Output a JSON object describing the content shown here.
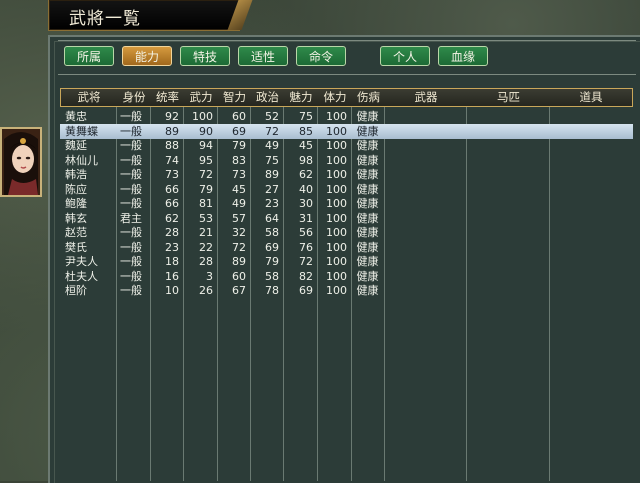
{
  "window": {
    "title": "武將一覧"
  },
  "tabs": [
    {
      "label": "所属",
      "active": false
    },
    {
      "label": "能力",
      "active": true
    },
    {
      "label": "特技",
      "active": false
    },
    {
      "label": "适性",
      "active": false
    },
    {
      "label": "命令",
      "active": false
    },
    {
      "label": "个人",
      "active": false
    },
    {
      "label": "血缘",
      "active": false
    }
  ],
  "columns": [
    "武将",
    "身份",
    "统率",
    "武力",
    "智力",
    "政治",
    "魅力",
    "体力",
    "伤病",
    "武器",
    "马匹",
    "道具"
  ],
  "rows": [
    {
      "name": "黄忠",
      "rank": "一般",
      "lead": "92",
      "war": "100",
      "int": "60",
      "pol": "52",
      "chr": "75",
      "hp": "100",
      "inj": "健康",
      "weapon": "",
      "horse": "",
      "item": ""
    },
    {
      "name": "黄舞蝶",
      "rank": "一般",
      "lead": "89",
      "war": "90",
      "int": "69",
      "pol": "72",
      "chr": "85",
      "hp": "100",
      "inj": "健康",
      "weapon": "",
      "horse": "",
      "item": ""
    },
    {
      "name": "魏延",
      "rank": "一般",
      "lead": "88",
      "war": "94",
      "int": "79",
      "pol": "49",
      "chr": "45",
      "hp": "100",
      "inj": "健康",
      "weapon": "",
      "horse": "",
      "item": ""
    },
    {
      "name": "林仙儿",
      "rank": "一般",
      "lead": "74",
      "war": "95",
      "int": "83",
      "pol": "75",
      "chr": "98",
      "hp": "100",
      "inj": "健康",
      "weapon": "",
      "horse": "",
      "item": ""
    },
    {
      "name": "韩浩",
      "rank": "一般",
      "lead": "73",
      "war": "72",
      "int": "73",
      "pol": "89",
      "chr": "62",
      "hp": "100",
      "inj": "健康",
      "weapon": "",
      "horse": "",
      "item": ""
    },
    {
      "name": "陈应",
      "rank": "一般",
      "lead": "66",
      "war": "79",
      "int": "45",
      "pol": "27",
      "chr": "40",
      "hp": "100",
      "inj": "健康",
      "weapon": "",
      "horse": "",
      "item": ""
    },
    {
      "name": "鲍隆",
      "rank": "一般",
      "lead": "66",
      "war": "81",
      "int": "49",
      "pol": "23",
      "chr": "30",
      "hp": "100",
      "inj": "健康",
      "weapon": "",
      "horse": "",
      "item": ""
    },
    {
      "name": "韩玄",
      "rank": "君主",
      "lead": "62",
      "war": "53",
      "int": "57",
      "pol": "64",
      "chr": "31",
      "hp": "100",
      "inj": "健康",
      "weapon": "",
      "horse": "",
      "item": ""
    },
    {
      "name": "赵范",
      "rank": "一般",
      "lead": "28",
      "war": "21",
      "int": "32",
      "pol": "58",
      "chr": "56",
      "hp": "100",
      "inj": "健康",
      "weapon": "",
      "horse": "",
      "item": ""
    },
    {
      "name": "樊氏",
      "rank": "一般",
      "lead": "23",
      "war": "22",
      "int": "72",
      "pol": "69",
      "chr": "76",
      "hp": "100",
      "inj": "健康",
      "weapon": "",
      "horse": "",
      "item": ""
    },
    {
      "name": "尹夫人",
      "rank": "一般",
      "lead": "18",
      "war": "28",
      "int": "89",
      "pol": "79",
      "chr": "72",
      "hp": "100",
      "inj": "健康",
      "weapon": "",
      "horse": "",
      "item": ""
    },
    {
      "name": "杜夫人",
      "rank": "一般",
      "lead": "16",
      "war": "3",
      "int": "60",
      "pol": "58",
      "chr": "82",
      "hp": "100",
      "inj": "健康",
      "weapon": "",
      "horse": "",
      "item": ""
    },
    {
      "name": "桓阶",
      "rank": "一般",
      "lead": "10",
      "war": "26",
      "int": "67",
      "pol": "78",
      "chr": "69",
      "hp": "100",
      "inj": "健康",
      "weapon": "",
      "horse": "",
      "item": ""
    }
  ],
  "selected_row": 1,
  "portrait": {
    "icon": "officer-portrait"
  },
  "colors": {
    "tab": "#1f7a3f",
    "tab_active": "#b87a28",
    "header_border": "#c9a75a",
    "selection": "#c3d4e3",
    "panel": "#2c3c38"
  }
}
